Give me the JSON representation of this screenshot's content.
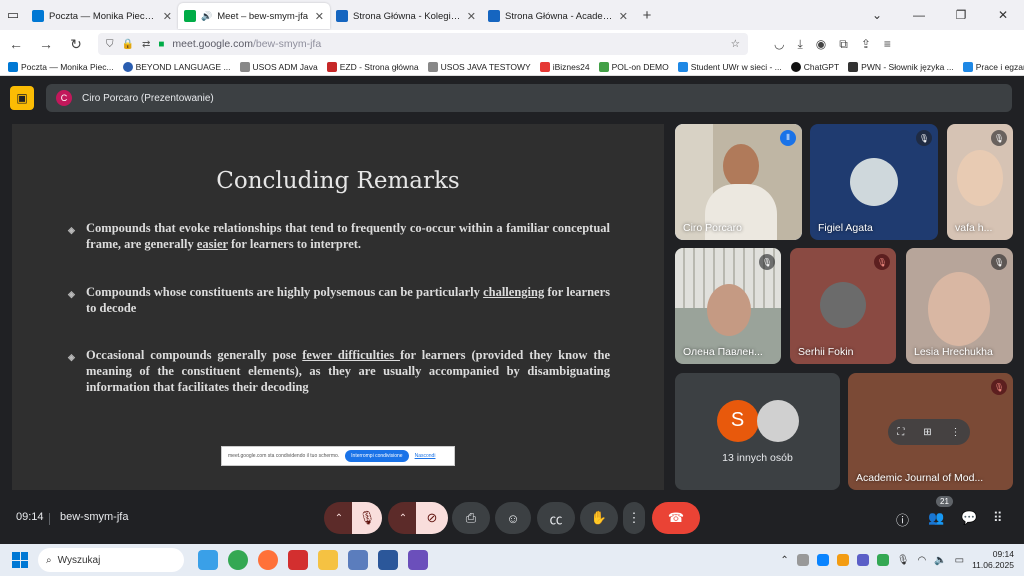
{
  "browser": {
    "tabs": [
      {
        "label": "Poczta — Monika Piechota — O",
        "color": "#0078d4",
        "active": false
      },
      {
        "label": "Meet – bew-smym-jfa",
        "color": "#00ac47",
        "active": true
      },
      {
        "label": "Strona Główna - Kolegium Międ",
        "color": "#1565c0",
        "active": false
      },
      {
        "label": "Strona Główna - Academic Journ",
        "color": "#1565c0",
        "active": false
      }
    ],
    "url_host": "meet.google.com",
    "url_path": "/bew-smym-jfa",
    "bookmarks": [
      {
        "label": "Poczta — Monika Piec...",
        "color": "#0078d4"
      },
      {
        "label": "BEYOND LANGUAGE ...",
        "color": "#2a5db0"
      },
      {
        "label": "USOS ADM Java",
        "color": "#888"
      },
      {
        "label": "EZD - Strona główna",
        "color": "#c62828"
      },
      {
        "label": "USOS JAVA TESTOWY",
        "color": "#888"
      },
      {
        "label": "iBiznes24",
        "color": "#e53935"
      },
      {
        "label": "POL-on DEMO",
        "color": "#43a047"
      },
      {
        "label": "Student UWr w sieci - ...",
        "color": "#1e88e5"
      },
      {
        "label": "ChatGPT",
        "color": "#111"
      },
      {
        "label": "PWN - Słownik języka ...",
        "color": "#333"
      },
      {
        "label": "Prace i egzaminy dypl...",
        "color": "#1e88e5"
      }
    ]
  },
  "meet": {
    "presenter_initial": "C",
    "presenter_label": "Ciro Porcaro (Prezentowanie)",
    "slide": {
      "title": "Concluding Remarks",
      "b1_pre": "Compounds that evoke relationships that tend to frequently co-occur within a familiar conceptual frame, are generally ",
      "b1_u": "easier",
      "b1_post": " for learners to interpret.",
      "b2_pre": "Compounds whose constituents are highly polysemous can be particularly ",
      "b2_u": "challenging",
      "b2_post": " for learners to decode",
      "b3_pre": "Occasional compounds generally pose ",
      "b3_u": "fewer difficulties ",
      "b3_post": "for learners (provided they know the meaning of the constituent elements), as they are usually accompanied by disambiguating information that facilitates their decoding"
    },
    "share_bar": {
      "text": "meet.google.com sta condividendo il tuo schermo.",
      "stop": "Interrompi condivisione",
      "hide": "Nascondi"
    },
    "participants": [
      {
        "name": "Ciro Porcaro"
      },
      {
        "name": "Figiel Agata"
      },
      {
        "name": "vafa h..."
      },
      {
        "name": "Олена Павлен..."
      },
      {
        "name": "Serhii Fokin"
      },
      {
        "name": "Lesia Hrechukha"
      },
      {
        "name": "Academic Journal of Mod..."
      }
    ],
    "others_initial": "S",
    "others_label": "13 innych osób",
    "time": "09:14",
    "meeting_code": "bew-smym-jfa",
    "participant_count": "21"
  },
  "taskbar": {
    "search_placeholder": "Wyszukaj",
    "time": "09:14",
    "date": "11.06.2025"
  }
}
